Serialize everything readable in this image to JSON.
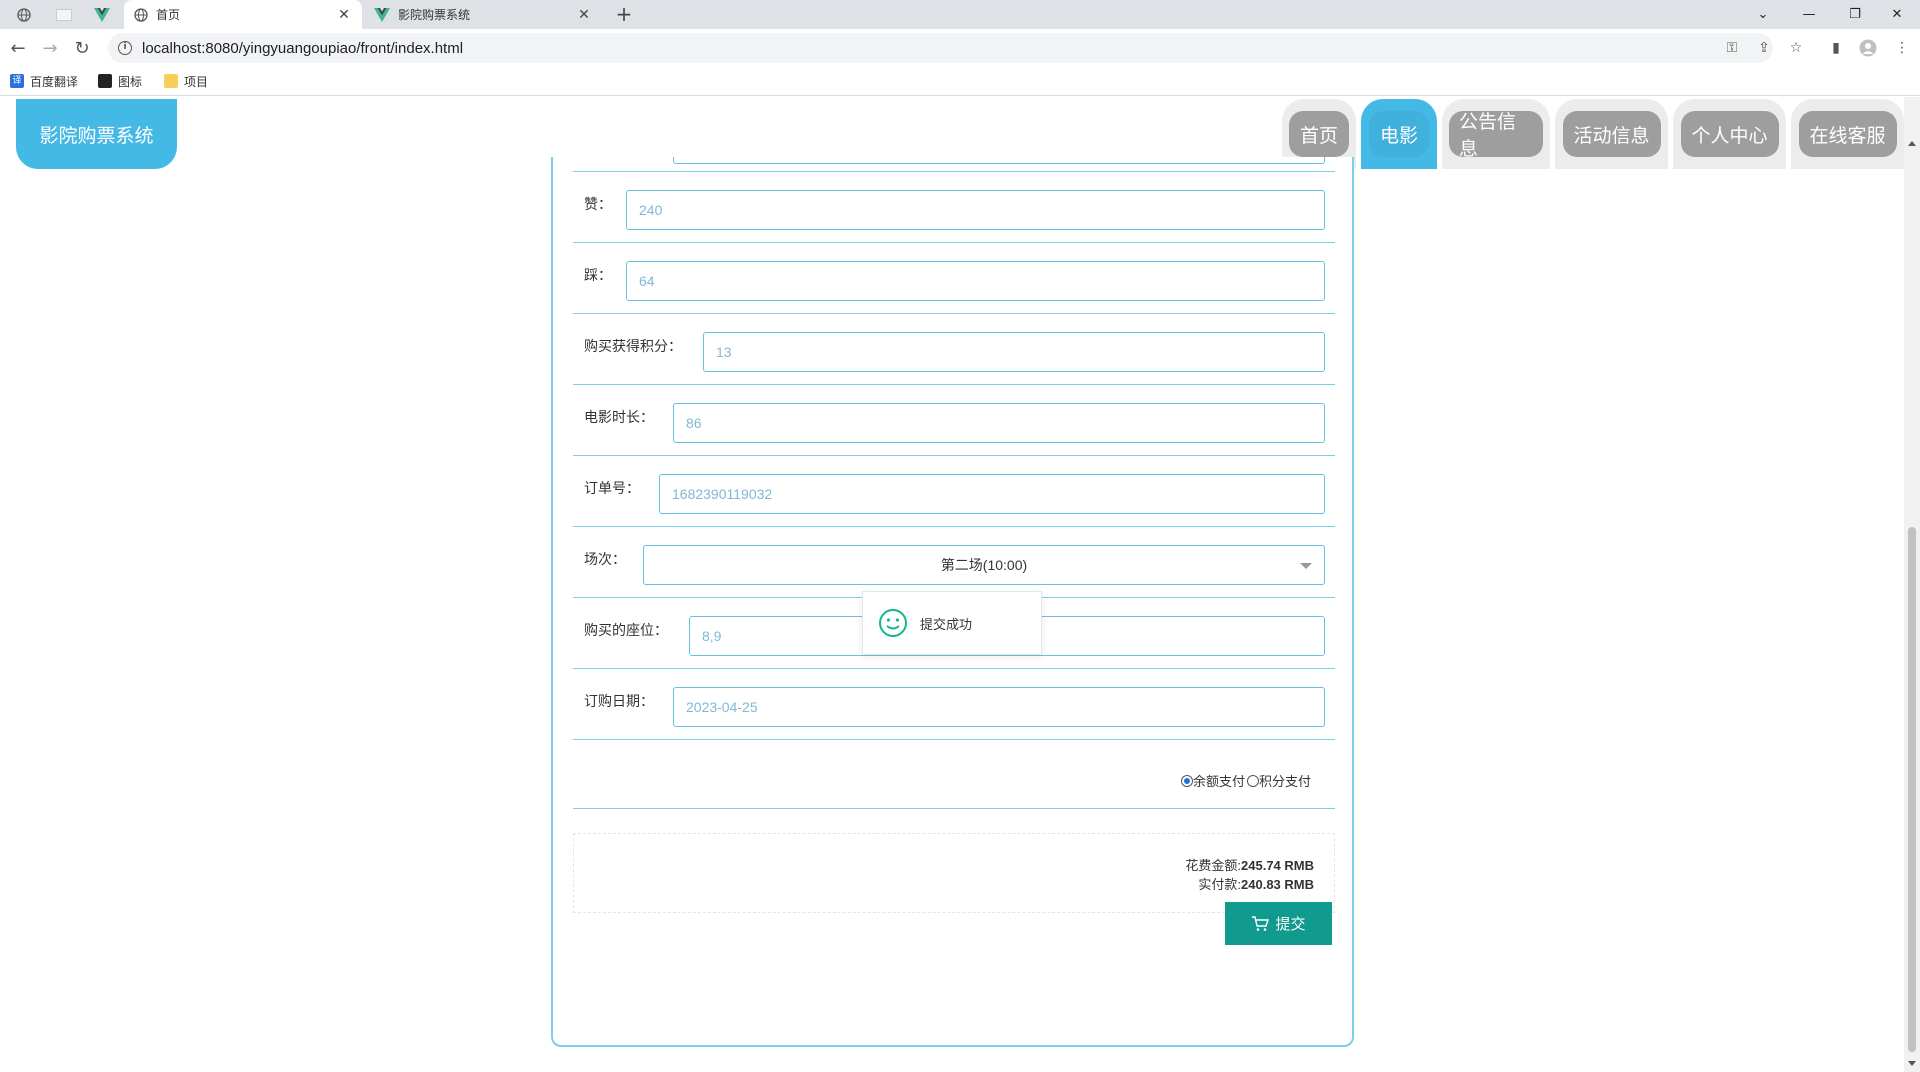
{
  "browser": {
    "tabs": [
      {
        "title": "首页",
        "active": true
      },
      {
        "title": "影院购票系统",
        "active": false
      }
    ],
    "url": "localhost:8080/yingyuangoupiao/front/index.html",
    "bookmarks": [
      {
        "label": "百度翻译"
      },
      {
        "label": "图标"
      },
      {
        "label": "项目"
      }
    ]
  },
  "site": {
    "logo": "影院购票系统",
    "nav": [
      {
        "label": "首页",
        "active": false
      },
      {
        "label": "电影",
        "active": true
      },
      {
        "label": "公告信息",
        "active": false
      },
      {
        "label": "活动信息",
        "active": false
      },
      {
        "label": "个人中心",
        "active": false
      },
      {
        "label": "在线客服",
        "active": false
      }
    ]
  },
  "form": {
    "fields": [
      {
        "label": "赞：",
        "value": "240"
      },
      {
        "label": "踩：",
        "value": "64"
      },
      {
        "label": "购买获得积分：",
        "value": "13"
      },
      {
        "label": "电影时长：",
        "value": "86"
      },
      {
        "label": "订单号：",
        "value": "1682390119032"
      },
      {
        "label": "场次：",
        "value": "第二场(10:00)"
      },
      {
        "label": "购买的座位：",
        "value": "8,9"
      },
      {
        "label": "订购日期：",
        "value": "2023-04-25"
      }
    ],
    "payment": {
      "balance": "余额支付",
      "points": "积分支付",
      "selected": "balance"
    },
    "summary": {
      "cost_label": "花费金额:",
      "cost_value": "245.74 RMB",
      "paid_label": "实付款:",
      "paid_value": "240.83 RMB"
    },
    "submit_label": "提交"
  },
  "toast": {
    "message": "提交成功"
  }
}
